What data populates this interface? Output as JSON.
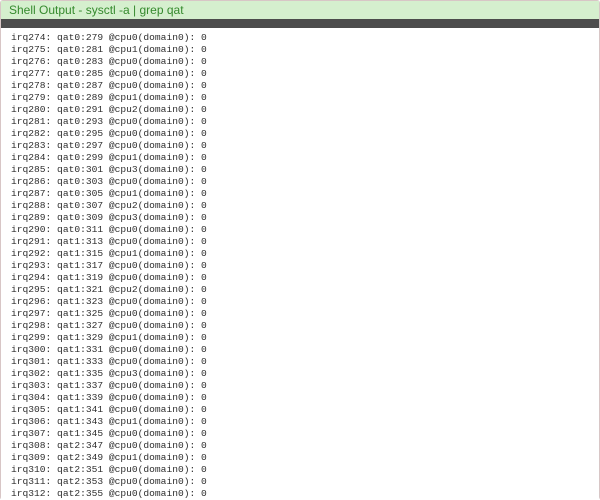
{
  "header": {
    "title_prefix": "Shell Output - ",
    "command": "sysctl -a | grep qat"
  },
  "rows": [
    {
      "irq": 274,
      "dev": "qat0",
      "n": 279,
      "cpu": 0,
      "domain": 0,
      "count": 0
    },
    {
      "irq": 275,
      "dev": "qat0",
      "n": 281,
      "cpu": 1,
      "domain": 0,
      "count": 0
    },
    {
      "irq": 276,
      "dev": "qat0",
      "n": 283,
      "cpu": 0,
      "domain": 0,
      "count": 0
    },
    {
      "irq": 277,
      "dev": "qat0",
      "n": 285,
      "cpu": 0,
      "domain": 0,
      "count": 0
    },
    {
      "irq": 278,
      "dev": "qat0",
      "n": 287,
      "cpu": 0,
      "domain": 0,
      "count": 0
    },
    {
      "irq": 279,
      "dev": "qat0",
      "n": 289,
      "cpu": 1,
      "domain": 0,
      "count": 0
    },
    {
      "irq": 280,
      "dev": "qat0",
      "n": 291,
      "cpu": 2,
      "domain": 0,
      "count": 0
    },
    {
      "irq": 281,
      "dev": "qat0",
      "n": 293,
      "cpu": 0,
      "domain": 0,
      "count": 0
    },
    {
      "irq": 282,
      "dev": "qat0",
      "n": 295,
      "cpu": 0,
      "domain": 0,
      "count": 0
    },
    {
      "irq": 283,
      "dev": "qat0",
      "n": 297,
      "cpu": 0,
      "domain": 0,
      "count": 0
    },
    {
      "irq": 284,
      "dev": "qat0",
      "n": 299,
      "cpu": 1,
      "domain": 0,
      "count": 0
    },
    {
      "irq": 285,
      "dev": "qat0",
      "n": 301,
      "cpu": 3,
      "domain": 0,
      "count": 0
    },
    {
      "irq": 286,
      "dev": "qat0",
      "n": 303,
      "cpu": 0,
      "domain": 0,
      "count": 0
    },
    {
      "irq": 287,
      "dev": "qat0",
      "n": 305,
      "cpu": 1,
      "domain": 0,
      "count": 0
    },
    {
      "irq": 288,
      "dev": "qat0",
      "n": 307,
      "cpu": 2,
      "domain": 0,
      "count": 0
    },
    {
      "irq": 289,
      "dev": "qat0",
      "n": 309,
      "cpu": 3,
      "domain": 0,
      "count": 0
    },
    {
      "irq": 290,
      "dev": "qat0",
      "n": 311,
      "cpu": 0,
      "domain": 0,
      "count": 0
    },
    {
      "irq": 291,
      "dev": "qat1",
      "n": 313,
      "cpu": 0,
      "domain": 0,
      "count": 0
    },
    {
      "irq": 292,
      "dev": "qat1",
      "n": 315,
      "cpu": 1,
      "domain": 0,
      "count": 0
    },
    {
      "irq": 293,
      "dev": "qat1",
      "n": 317,
      "cpu": 0,
      "domain": 0,
      "count": 0
    },
    {
      "irq": 294,
      "dev": "qat1",
      "n": 319,
      "cpu": 0,
      "domain": 0,
      "count": 0
    },
    {
      "irq": 295,
      "dev": "qat1",
      "n": 321,
      "cpu": 2,
      "domain": 0,
      "count": 0
    },
    {
      "irq": 296,
      "dev": "qat1",
      "n": 323,
      "cpu": 0,
      "domain": 0,
      "count": 0
    },
    {
      "irq": 297,
      "dev": "qat1",
      "n": 325,
      "cpu": 0,
      "domain": 0,
      "count": 0
    },
    {
      "irq": 298,
      "dev": "qat1",
      "n": 327,
      "cpu": 0,
      "domain": 0,
      "count": 0
    },
    {
      "irq": 299,
      "dev": "qat1",
      "n": 329,
      "cpu": 1,
      "domain": 0,
      "count": 0
    },
    {
      "irq": 300,
      "dev": "qat1",
      "n": 331,
      "cpu": 0,
      "domain": 0,
      "count": 0
    },
    {
      "irq": 301,
      "dev": "qat1",
      "n": 333,
      "cpu": 0,
      "domain": 0,
      "count": 0
    },
    {
      "irq": 302,
      "dev": "qat1",
      "n": 335,
      "cpu": 3,
      "domain": 0,
      "count": 0
    },
    {
      "irq": 303,
      "dev": "qat1",
      "n": 337,
      "cpu": 0,
      "domain": 0,
      "count": 0
    },
    {
      "irq": 304,
      "dev": "qat1",
      "n": 339,
      "cpu": 0,
      "domain": 0,
      "count": 0
    },
    {
      "irq": 305,
      "dev": "qat1",
      "n": 341,
      "cpu": 0,
      "domain": 0,
      "count": 0
    },
    {
      "irq": 306,
      "dev": "qat1",
      "n": 343,
      "cpu": 1,
      "domain": 0,
      "count": 0
    },
    {
      "irq": 307,
      "dev": "qat1",
      "n": 345,
      "cpu": 0,
      "domain": 0,
      "count": 0
    },
    {
      "irq": 308,
      "dev": "qat2",
      "n": 347,
      "cpu": 0,
      "domain": 0,
      "count": 0
    },
    {
      "irq": 309,
      "dev": "qat2",
      "n": 349,
      "cpu": 1,
      "domain": 0,
      "count": 0
    },
    {
      "irq": 310,
      "dev": "qat2",
      "n": 351,
      "cpu": 0,
      "domain": 0,
      "count": 0
    },
    {
      "irq": 311,
      "dev": "qat2",
      "n": 353,
      "cpu": 0,
      "domain": 0,
      "count": 0
    },
    {
      "irq": 312,
      "dev": "qat2",
      "n": 355,
      "cpu": 0,
      "domain": 0,
      "count": 0
    }
  ]
}
